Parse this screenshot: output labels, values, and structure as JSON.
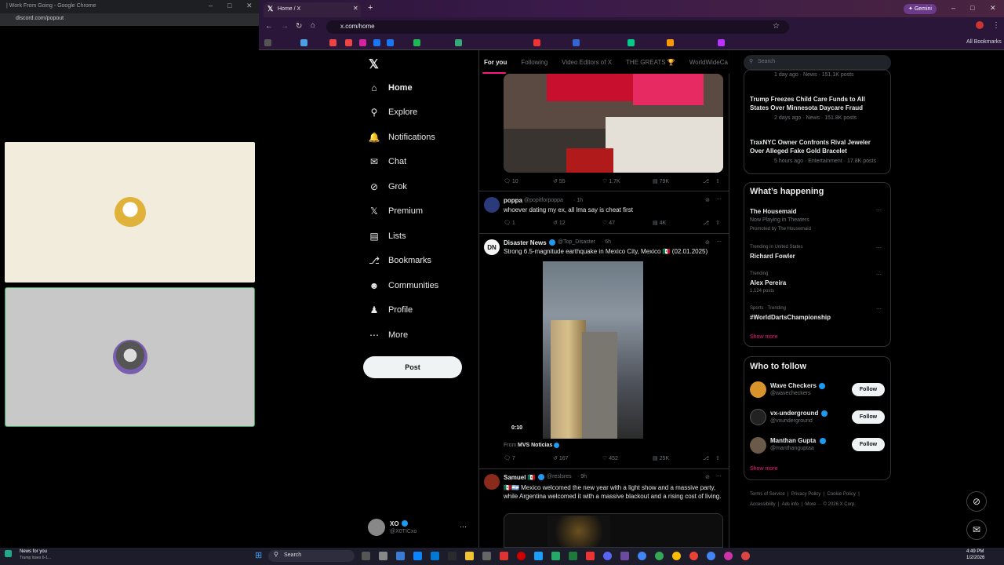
{
  "discord": {
    "title": "| Work From Going - Google Chrome",
    "url": "discord.com/popout"
  },
  "chrome": {
    "tab_title": "Home / X",
    "url": "x.com/home",
    "gemini_label": "Gemini",
    "all_bookmarks": "All Bookmarks"
  },
  "nav": {
    "items": [
      {
        "label": "Home",
        "icon": "home-icon"
      },
      {
        "label": "Explore",
        "icon": "search-icon"
      },
      {
        "label": "Notifications",
        "icon": "bell-icon"
      },
      {
        "label": "Chat",
        "icon": "mail-icon"
      },
      {
        "label": "Grok",
        "icon": "grok-icon"
      },
      {
        "label": "Premium",
        "icon": "x-icon"
      },
      {
        "label": "Lists",
        "icon": "list-icon"
      },
      {
        "label": "Bookmarks",
        "icon": "bookmark-icon"
      },
      {
        "label": "Communities",
        "icon": "people-icon"
      },
      {
        "label": "Profile",
        "icon": "person-icon"
      },
      {
        "label": "More",
        "icon": "more-icon"
      }
    ],
    "post_label": "Post",
    "account_name": "XO",
    "account_handle": "@X0TICxo"
  },
  "feed_tabs": [
    "For you",
    "Following",
    "Video Editors of X",
    "THE GREATS 🏆",
    "WorldWideCa"
  ],
  "tweets": [
    {
      "stats": {
        "replies": "10",
        "reposts": "55",
        "likes": "1.7K",
        "views": "79K"
      }
    },
    {
      "name": "poppa",
      "handle": "@popitforpoppa",
      "time": "· 1h",
      "text": "whoever dating my ex, all lma say is cheat first",
      "stats": {
        "replies": "1",
        "reposts": "12",
        "likes": "47",
        "views": "4K"
      }
    },
    {
      "name": "Disaster News",
      "handle": "@Top_Disaster",
      "time": "· 6h",
      "avatar_text": "DN",
      "text": "Strong 6.5-magnitude earthquake in Mexico City, Mexico 🇲🇽 (02.01.2025)",
      "video_time": "0:10",
      "from_label": "From",
      "from_source": "MVS Noticias",
      "stats": {
        "replies": "7",
        "reposts": "167",
        "likes": "452",
        "views": "25K"
      }
    },
    {
      "name": "Samuel 🇲🇽",
      "handle": "@reslsres",
      "time": "· 9h",
      "text": "🇲🇽🇦🇷 Mexico welcomed the new year with a light show and a massive party, while Argentina welcomed it with a massive blackout and a rising cost of living."
    }
  ],
  "search_placeholder": "Search",
  "trending_top": [
    {
      "meta": "1 day ago · News · 151.1K posts"
    },
    {
      "title": "Trump Freezes Child Care Funds to All States Over Minnesota Daycare Fraud",
      "meta": "2 days ago · News · 151.8K posts"
    },
    {
      "title": "TraxNYC Owner Confronts Rival Jeweler Over Alleged Fake Gold Bracelet",
      "meta": "5 hours ago · Entertainment · 17.8K posts"
    }
  ],
  "whats_happening": {
    "heading": "What’s happening",
    "items": [
      {
        "context": "",
        "title": "The Housemaid",
        "sub": "Now Playing in Theaters",
        "promo": "Promoted by The Housemaid"
      },
      {
        "context": "Trending in United States",
        "title": "Richard Fowler",
        "sub": ""
      },
      {
        "context": "Trending",
        "title": "Alex Pereira",
        "sub": "1,124 posts"
      },
      {
        "context": "Sports · Trending",
        "title": "#WorldDartsChampionship",
        "sub": ""
      }
    ],
    "show_more": "Show more"
  },
  "who_to_follow": {
    "heading": "Who to follow",
    "accounts": [
      {
        "name": "Wave Checkers",
        "handle": "@wavecheckers"
      },
      {
        "name": "vx-underground",
        "handle": "@vxunderground"
      },
      {
        "name": "Manthan Gupta",
        "handle": "@manthanguptaa"
      }
    ],
    "follow_label": "Follow",
    "show_more": "Show more"
  },
  "footer_links": [
    "Terms of Service",
    "Privacy Policy",
    "Cookie Policy",
    "Accessibility",
    "Ads info",
    "More ···",
    "© 2026 X Corp."
  ],
  "taskbar": {
    "search_label": "Search",
    "news_title": "News for you",
    "news_sub": "Trump loses 6-1...",
    "time": "4:49 PM",
    "date": "1/2/2026"
  },
  "colors": {
    "accent": "#1d9bf0",
    "pink": "#f91880",
    "verified": "#1d9bf0"
  }
}
